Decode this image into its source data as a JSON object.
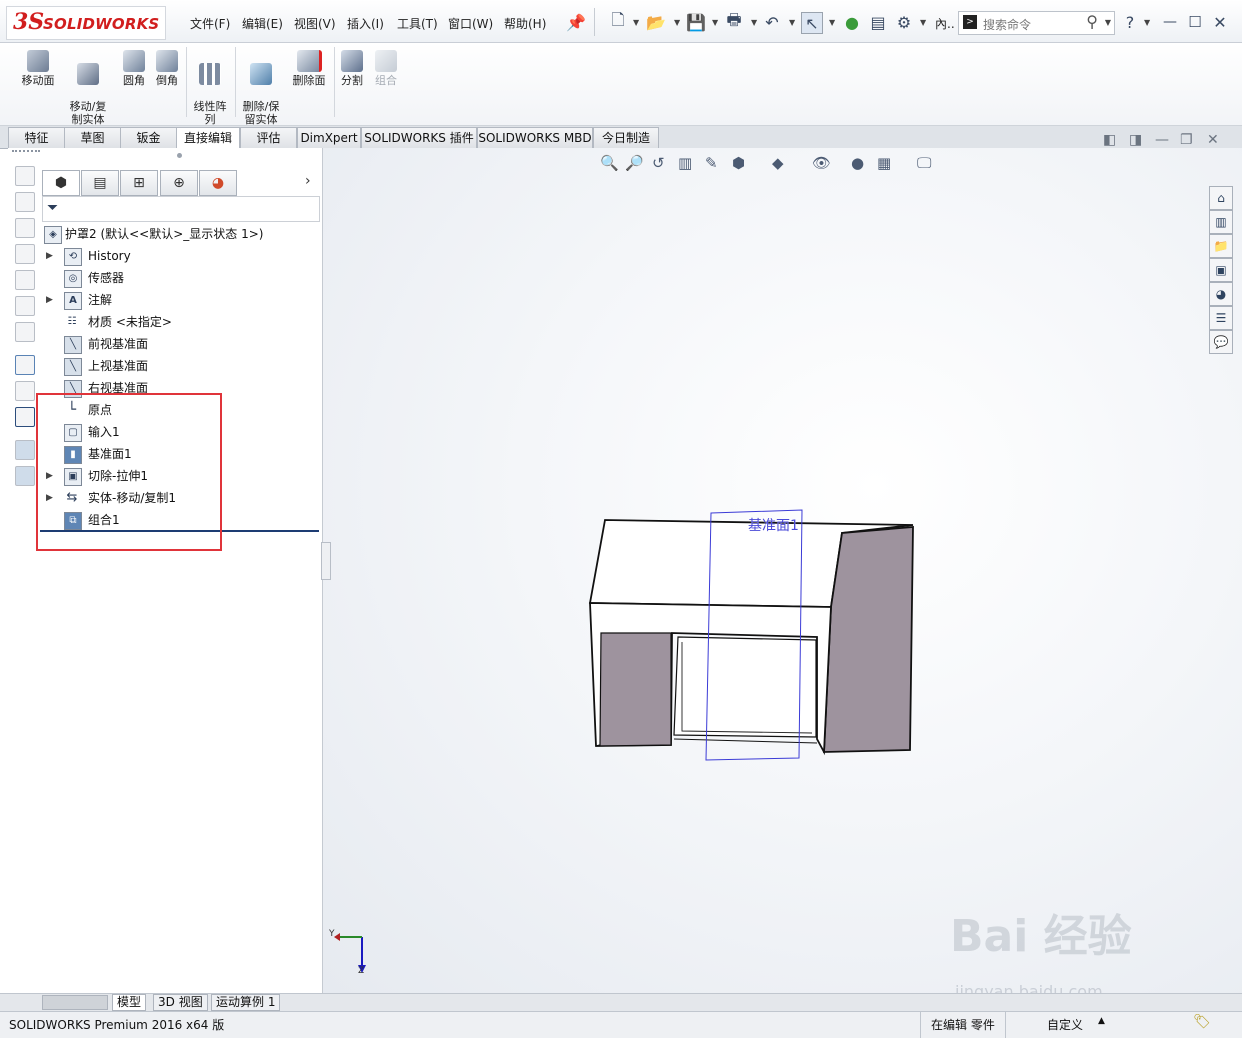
{
  "app": {
    "brand_prefix": "3S",
    "brand": "SOLIDWORKS",
    "status": "SOLIDWORKS Premium 2016 x64 版",
    "status_mode": "在编辑 零件",
    "status_units": "自定义"
  },
  "menu": [
    "文件(F)",
    "编辑(E)",
    "视图(V)",
    "插入(I)",
    "工具(T)",
    "窗口(W)",
    "帮助(H)"
  ],
  "search": {
    "placeholder": "搜索命令",
    "truncated_label": "內.."
  },
  "command_manager": {
    "buttons": [
      {
        "label": "移动面"
      },
      {
        "label": "移动/复\n制实体"
      },
      {
        "label": "圆角"
      },
      {
        "label": "倒角"
      },
      {
        "label": "线性阵\n列"
      },
      {
        "label": "删除/保\n留实体"
      },
      {
        "label": "删除面"
      },
      {
        "label": "分割"
      },
      {
        "label": "组合"
      }
    ],
    "tabs": [
      "特征",
      "草图",
      "钣金",
      "直接编辑",
      "评估",
      "DimXpert",
      "SOLIDWORKS 插件",
      "SOLIDWORKS MBD",
      "今日制造"
    ],
    "active_tab": "直接编辑"
  },
  "feature_tree": {
    "root": "护罩2 (默认<<默认>_显示状态 1>)",
    "nodes": [
      {
        "label": "History",
        "expandable": true
      },
      {
        "label": "传感器",
        "expandable": false
      },
      {
        "label": "注解",
        "expandable": true
      },
      {
        "label": "材质 <未指定>",
        "expandable": false
      },
      {
        "label": "前视基准面",
        "expandable": false
      },
      {
        "label": "上视基准面",
        "expandable": false
      },
      {
        "label": "右视基准面",
        "expandable": false
      },
      {
        "label": "原点",
        "expandable": false
      },
      {
        "label": "输入1",
        "expandable": false
      },
      {
        "label": "基准面1",
        "expandable": false
      },
      {
        "label": "切除-拉伸1",
        "expandable": true
      },
      {
        "label": "实体-移动/复制1",
        "expandable": true
      },
      {
        "label": "组合1",
        "expandable": false
      }
    ]
  },
  "viewport": {
    "plane_label": "基准面1",
    "triad": {
      "y": "Y",
      "z": "Z"
    }
  },
  "bottom_tabs": [
    "模型",
    "3D 视图",
    "运动算例 1"
  ],
  "watermark": {
    "main": "Bai 经验",
    "sub": "jingyan.baidu.com"
  },
  "colors": {
    "brand_red": "#d11e1e",
    "highlight_box": "#e0343a",
    "model_side": "#9e939e"
  }
}
